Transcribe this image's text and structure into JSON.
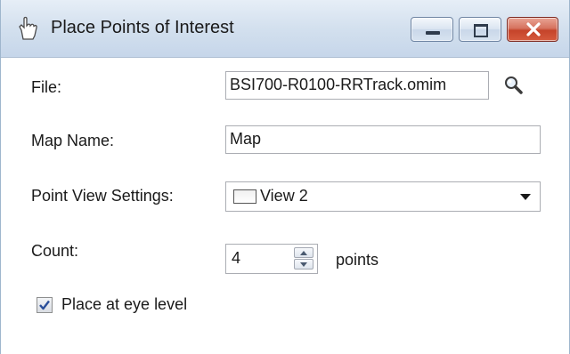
{
  "window": {
    "title": "Place Points of Interest",
    "accent_color": "#c5432a"
  },
  "titlebar_buttons": {
    "minimize_icon": "minimize-icon",
    "maximize_icon": "maximize-icon",
    "close_icon": "close-icon"
  },
  "form": {
    "file_label": "File:",
    "file_value": "BSI700-R0100-RRTrack.omim",
    "map_name_label": "Map Name:",
    "map_name_value": "Map",
    "view_settings_label": "Point View Settings:",
    "view_settings_value": "View 2",
    "count_label": "Count:",
    "count_value": "4",
    "count_unit": "points",
    "eye_level_label": "Place at eye level",
    "eye_level_checked": true
  }
}
